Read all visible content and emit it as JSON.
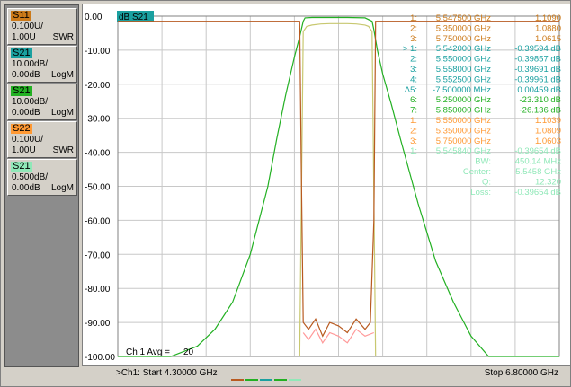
{
  "traces": [
    {
      "name": "S11",
      "scale": "0.100U/",
      "ref": "1.00U",
      "format": "SWR",
      "color": "#cc7a1a"
    },
    {
      "name": "S21",
      "scale": "10.00dB/",
      "ref": "0.00dB",
      "format": "LogM",
      "color": "#1aa0a0"
    },
    {
      "name": "S21",
      "scale": "10.00dB/",
      "ref": "0.00dB",
      "format": "LogM",
      "color": "#22b022"
    },
    {
      "name": "S22",
      "scale": "0.100U/",
      "ref": "1.00U",
      "format": "SWR",
      "color": "#ff9933"
    },
    {
      "name": "S21",
      "scale": "0.500dB/",
      "ref": "0.00dB",
      "format": "LogM",
      "color": "#90e8b8"
    }
  ],
  "plot": {
    "active_trace_label": "dB S21",
    "y_ticks": [
      "0.00",
      "-10.00",
      "-20.00",
      "-30.00",
      "-40.00",
      "-50.00",
      "-60.00",
      "-70.00",
      "-80.00",
      "-90.00",
      "-100.00"
    ],
    "avg_label": "Ch 1 Avg =",
    "avg_value": "20"
  },
  "markers": [
    {
      "id": "1:",
      "freq": "5.547500 GHz",
      "val": "1.1090",
      "color": "#cc7a1a"
    },
    {
      "id": "2:",
      "freq": "5.350000 GHz",
      "val": "1.0880",
      "color": "#cc7a1a"
    },
    {
      "id": "3:",
      "freq": "5.750000 GHz",
      "val": "1.0615",
      "color": "#cc7a1a"
    },
    {
      "id": "> 1:",
      "freq": "5.542000 GHz",
      "val": "-0.39594 dB",
      "color": "#1aa0a0"
    },
    {
      "id": "2:",
      "freq": "5.550000 GHz",
      "val": "-0.39857 dB",
      "color": "#1aa0a0"
    },
    {
      "id": "3:",
      "freq": "5.558000 GHz",
      "val": "-0.39691 dB",
      "color": "#1aa0a0"
    },
    {
      "id": "4:",
      "freq": "5.552500 GHz",
      "val": "-0.39961 dB",
      "color": "#1aa0a0"
    },
    {
      "id": "Δ5:",
      "freq": "-7.500000 MHz",
      "val": "0.00459 dB",
      "color": "#1aa0a0"
    },
    {
      "id": "6:",
      "freq": "5.250000 GHz",
      "val": "-23.310 dB",
      "color": "#22b022"
    },
    {
      "id": "7:",
      "freq": "5.850000 GHz",
      "val": "-26.136 dB",
      "color": "#22b022"
    },
    {
      "id": "1:",
      "freq": "5.550000 GHz",
      "val": "1.1039",
      "color": "#ff9933"
    },
    {
      "id": "2:",
      "freq": "5.350000 GHz",
      "val": "1.0809",
      "color": "#ff9933"
    },
    {
      "id": "3:",
      "freq": "5.750000 GHz",
      "val": "1.0603",
      "color": "#ff9933"
    },
    {
      "id": "1:",
      "freq": "5.545840 GHz",
      "val": "-0.39654 dB",
      "color": "#90e8b8"
    }
  ],
  "stats": [
    {
      "label": "BW:",
      "value": "450.14 MHz"
    },
    {
      "label": "Center:",
      "value": "5.5458 GHz"
    },
    {
      "label": "Q:",
      "value": "12.320"
    },
    {
      "label": "Loss:",
      "value": "-0.39654 dB"
    }
  ],
  "status": {
    "start": ">Ch1: Start  4.30000 GHz",
    "stop": "Stop  6.80000 GHz"
  },
  "chart_data": {
    "type": "line",
    "x_range": [
      4.3,
      6.8
    ],
    "ylim": [
      -100,
      0
    ],
    "grid": true,
    "series": [
      {
        "name": "S21 LogM 10dB/",
        "color": "#22b022",
        "x": [
          4.3,
          4.6,
          4.75,
          4.85,
          4.95,
          5.05,
          5.15,
          5.2,
          5.25,
          5.3,
          5.33,
          5.35,
          5.36,
          5.4,
          5.5,
          5.6,
          5.7,
          5.74,
          5.75,
          5.77,
          5.8,
          5.85,
          5.9,
          6.0,
          6.1,
          6.2,
          6.3,
          6.4,
          6.5,
          6.8
        ],
        "y": [
          -100,
          -100,
          -97,
          -92,
          -84,
          -70,
          -50,
          -36,
          -23.3,
          -12,
          -6,
          -1.5,
          -0.5,
          -0.4,
          -0.4,
          -0.4,
          -0.5,
          -1.5,
          -4,
          -10,
          -17,
          -26.1,
          -36,
          -55,
          -72,
          -84,
          -94,
          -100,
          -100,
          -100
        ]
      },
      {
        "name": "S21 LogM 0.5dB/",
        "color": "#c8c870",
        "x": [
          5.33,
          5.35,
          5.37,
          5.4,
          5.45,
          5.5,
          5.55,
          5.6,
          5.65,
          5.7,
          5.72,
          5.74,
          5.76
        ],
        "y": [
          -100,
          -4.5,
          -3,
          -2.6,
          -2.3,
          -2.2,
          -2.2,
          -2.2,
          -2.3,
          -2.6,
          -3,
          -4.5,
          -100
        ]
      },
      {
        "name": "S11 SWR",
        "color": "#b85a20",
        "x": [
          4.3,
          5.33,
          5.34,
          5.35,
          5.38,
          5.42,
          5.46,
          5.5,
          5.55,
          5.6,
          5.65,
          5.7,
          5.73,
          5.75,
          5.76,
          6.8
        ],
        "y": [
          -1.5,
          -1.5,
          -50,
          -90,
          -92,
          -89,
          -94,
          -90,
          -91,
          -93,
          -89,
          -92,
          -90,
          -60,
          -1.5,
          -1.5
        ]
      },
      {
        "name": "S22 SWR",
        "color": "#ff9999",
        "x": [
          5.35,
          5.38,
          5.42,
          5.46,
          5.5,
          5.55,
          5.6,
          5.65,
          5.7,
          5.75
        ],
        "y": [
          -93,
          -95,
          -92,
          -96,
          -93,
          -94,
          -96,
          -92,
          -94,
          -93
        ]
      }
    ]
  }
}
